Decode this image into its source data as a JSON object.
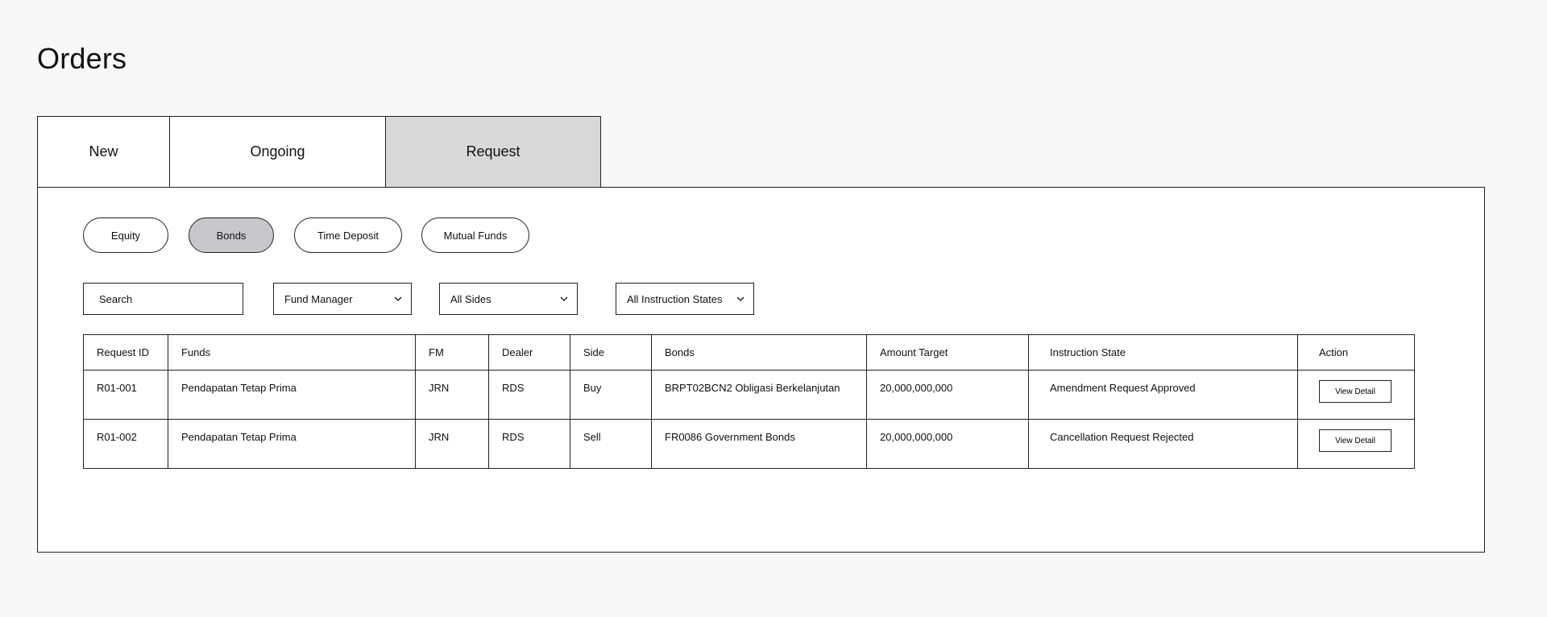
{
  "page": {
    "title": "Orders"
  },
  "tabs": [
    {
      "label": "New",
      "active": false
    },
    {
      "label": "Ongoing",
      "active": false
    },
    {
      "label": "Request",
      "active": true
    }
  ],
  "asset_filters": [
    {
      "label": "Equity",
      "active": false
    },
    {
      "label": "Bonds",
      "active": true
    },
    {
      "label": "Time Deposit",
      "active": false
    },
    {
      "label": "Mutual Funds",
      "active": false
    }
  ],
  "filters": {
    "search_placeholder": "Search",
    "fund_manager": "Fund Manager",
    "sides": "All Sides",
    "instruction_states": "All Instruction States"
  },
  "table": {
    "columns": [
      "Request ID",
      "Funds",
      "FM",
      "Dealer",
      "Side",
      "Bonds",
      "Amount Target",
      "Instruction State",
      "Action"
    ],
    "rows": [
      {
        "request_id": "R01-001",
        "funds": "Pendapatan Tetap Prima",
        "fm": "JRN",
        "dealer": "RDS",
        "side": "Buy",
        "bonds": "BRPT02BCN2 Obligasi Berkelanjutan",
        "amount_target": "20,000,000,000",
        "instruction_state": "Amendment Request Approved",
        "action": "View Detail"
      },
      {
        "request_id": "R01-002",
        "funds": "Pendapatan Tetap Prima",
        "fm": "JRN",
        "dealer": "RDS",
        "side": "Sell",
        "bonds": "FR0086 Government Bonds",
        "amount_target": "20,000,000,000",
        "instruction_state": "Cancellation Request Rejected",
        "action": "View Detail"
      }
    ]
  },
  "icons": {
    "dropdown": "chevron-down-icon"
  },
  "colors": {
    "active_tab": "#d9d9d9",
    "active_chip": "#c8c8cc",
    "border": "#222222",
    "background": "#f8f8f8"
  }
}
